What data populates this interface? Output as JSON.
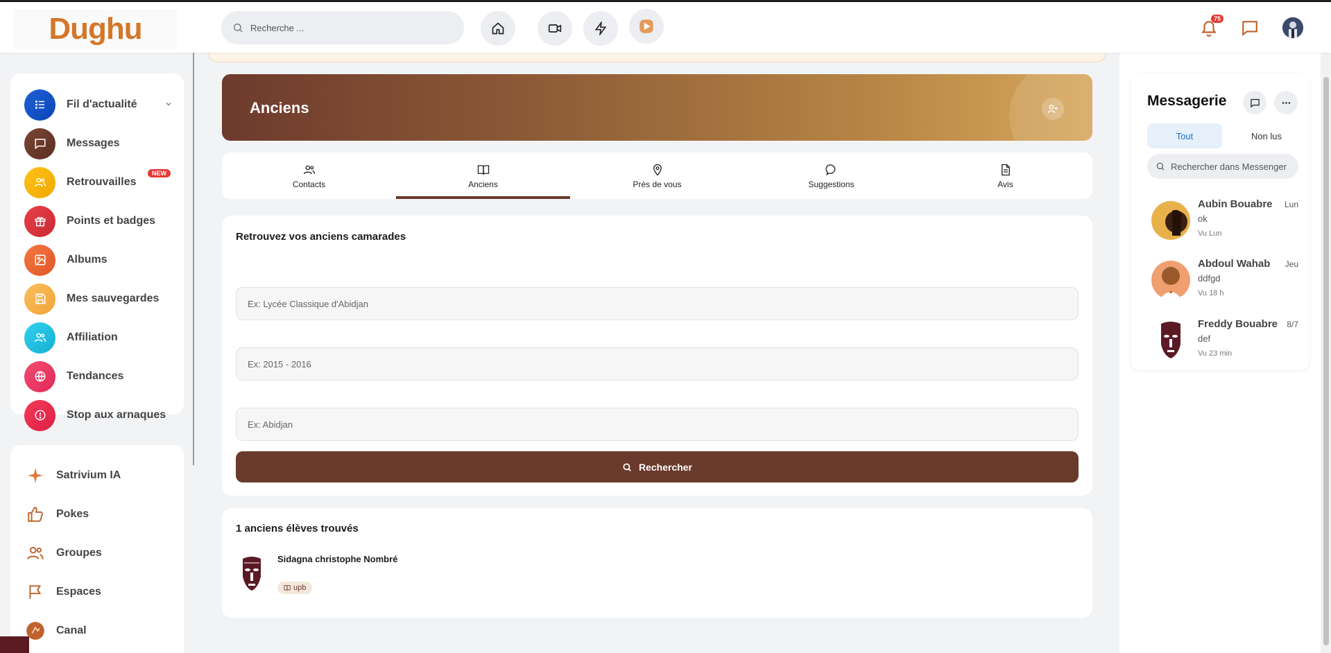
{
  "app": {
    "logo_text": "Dughu"
  },
  "topbar": {
    "search_placeholder": "Recherche ...",
    "notification_count": "75"
  },
  "sidebar": {
    "items": [
      {
        "label": "Fil d'actualité",
        "icon": "list-icon",
        "color": "#1f5fd6"
      },
      {
        "label": "Messages",
        "icon": "chat-icon",
        "color": "#6a3a2c"
      },
      {
        "label": "Retrouvailles",
        "icon": "users-icon",
        "color": "#f5b400",
        "badge": "NEW"
      },
      {
        "label": "Points et badges",
        "icon": "gift-icon",
        "color": "#e0383e"
      },
      {
        "label": "Albums",
        "icon": "image-icon",
        "color": "#ef6a3a"
      },
      {
        "label": "Mes sauvegardes",
        "icon": "save-icon",
        "color": "#f7b24a"
      },
      {
        "label": "Affiliation",
        "icon": "users-icon",
        "color": "#22c2e0"
      },
      {
        "label": "Tendances",
        "icon": "globe-icon",
        "color": "#ef3f62"
      },
      {
        "label": "Stop aux arnaques",
        "icon": "alert-icon",
        "color": "#ee2f4f"
      }
    ],
    "secondary": [
      {
        "label": "Satrivium IA",
        "icon": "sparkle-icon"
      },
      {
        "label": "Pokes",
        "icon": "thumbs-up-icon"
      },
      {
        "label": "Groupes",
        "icon": "group-icon"
      },
      {
        "label": "Espaces",
        "icon": "flag-icon"
      },
      {
        "label": "Canal",
        "icon": "channel-icon"
      }
    ]
  },
  "hero": {
    "title": "Anciens"
  },
  "tabs": [
    {
      "label": "Contacts",
      "active": false
    },
    {
      "label": "Anciens",
      "active": true
    },
    {
      "label": "Près de vous",
      "active": false
    },
    {
      "label": "Suggestions",
      "active": false
    },
    {
      "label": "Avis",
      "active": false
    }
  ],
  "search_form": {
    "title": "Retrouvez vos anciens camarades",
    "school_placeholder": "Ex: Lycée Classique d'Abidjan",
    "years_placeholder": "Ex: 2015 - 2016",
    "city_placeholder": "Ex: Abidjan",
    "button_label": "Rechercher"
  },
  "results": {
    "title": "1 anciens élèves trouvés",
    "items": [
      {
        "name": "Sidagna christophe Nombré",
        "school": "upb"
      }
    ]
  },
  "messenger": {
    "title": "Messagerie",
    "tab_all": "Tout",
    "tab_unread": "Non lus",
    "search_placeholder": "Rechercher dans Messenger",
    "conversations": [
      {
        "name": "Aubin Bouabre",
        "date": "Lun",
        "message": "ok",
        "seen": "Vu Lun"
      },
      {
        "name": "Abdoul Wahab",
        "date": "Jeu",
        "message": "ddfgd",
        "seen": "Vu 18 h"
      },
      {
        "name": "Freddy Bouabre",
        "date": "8/7",
        "message": "def",
        "seen": "Vu 23 min"
      }
    ]
  },
  "colors": {
    "brand": "#6a3a2c",
    "accent": "#d4772a"
  }
}
